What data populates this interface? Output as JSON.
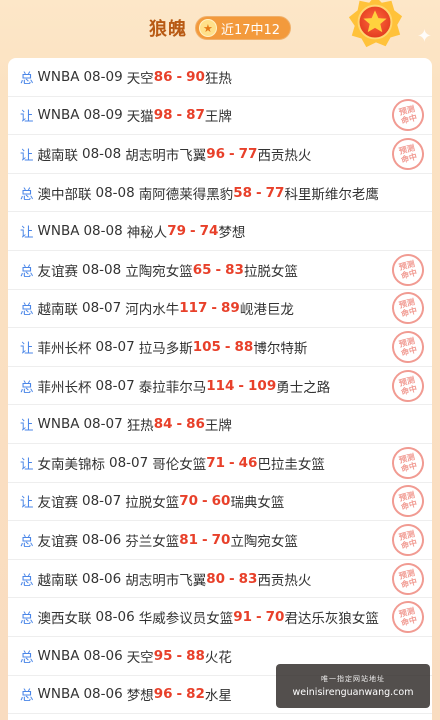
{
  "header": {
    "title": "狼魄",
    "badge_text": "近17中12",
    "badge_icon": "star-icon",
    "medal_icon": "star-medal-icon"
  },
  "stamp_text": {
    "line1": "预测",
    "line2": "命中"
  },
  "rows": [
    {
      "kind": "总",
      "league": "WNBA",
      "date": "08-09",
      "home": "天空",
      "score_home": "86",
      "score_away": "90",
      "away": "狂热",
      "hit": false
    },
    {
      "kind": "让",
      "league": "WNBA",
      "date": "08-09",
      "home": "天猫",
      "score_home": "98",
      "score_away": "87",
      "away": "王牌",
      "hit": true
    },
    {
      "kind": "让",
      "league": "越南联",
      "date": "08-08",
      "home": "胡志明市飞翼",
      "score_home": "96",
      "score_away": "77",
      "away": "西贡热火",
      "hit": true
    },
    {
      "kind": "总",
      "league": "澳中部联",
      "date": "08-08",
      "home": "南阿德莱得黑豹",
      "score_home": "58",
      "score_away": "77",
      "away": "科里斯维尔老鹰",
      "hit": false
    },
    {
      "kind": "让",
      "league": "WNBA",
      "date": "08-08",
      "home": "神秘人",
      "score_home": "79",
      "score_away": "74",
      "away": "梦想",
      "hit": false
    },
    {
      "kind": "总",
      "league": "友谊赛",
      "date": "08-08",
      "home": "立陶宛女篮",
      "score_home": "65",
      "score_away": "83",
      "away": "拉脱女篮",
      "hit": true
    },
    {
      "kind": "总",
      "league": "越南联",
      "date": "08-07",
      "home": "河内水牛",
      "score_home": "117",
      "score_away": "89",
      "away": "岘港巨龙",
      "hit": true
    },
    {
      "kind": "让",
      "league": "菲州长杯",
      "date": "08-07",
      "home": "拉马多斯",
      "score_home": "105",
      "score_away": "88",
      "away": "博尔特斯",
      "hit": true
    },
    {
      "kind": "总",
      "league": "菲州长杯",
      "date": "08-07",
      "home": "泰拉菲尔马",
      "score_home": "114",
      "score_away": "109",
      "away": "勇士之路",
      "hit": true
    },
    {
      "kind": "让",
      "league": "WNBA",
      "date": "08-07",
      "home": "狂热",
      "score_home": "84",
      "score_away": "86",
      "away": "王牌",
      "hit": false
    },
    {
      "kind": "让",
      "league": "女南美锦标",
      "date": "08-07",
      "home": "哥伦女篮",
      "score_home": "71",
      "score_away": "46",
      "away": "巴拉圭女篮",
      "hit": true
    },
    {
      "kind": "让",
      "league": "友谊赛",
      "date": "08-07",
      "home": "拉脱女篮",
      "score_home": "70",
      "score_away": "60",
      "away": "瑞典女篮",
      "hit": true
    },
    {
      "kind": "总",
      "league": "友谊赛",
      "date": "08-06",
      "home": "芬兰女篮",
      "score_home": "81",
      "score_away": "70",
      "away": "立陶宛女篮",
      "hit": true
    },
    {
      "kind": "总",
      "league": "越南联",
      "date": "08-06",
      "home": "胡志明市飞翼",
      "score_home": "80",
      "score_away": "83",
      "away": "西贡热火",
      "hit": true
    },
    {
      "kind": "总",
      "league": "澳西女联",
      "date": "08-06",
      "home": "华威参议员女篮",
      "score_home": "91",
      "score_away": "70",
      "away": "君达乐灰狼女篮",
      "hit": true
    },
    {
      "kind": "总",
      "league": "WNBA",
      "date": "08-06",
      "home": "天空",
      "score_home": "95",
      "score_away": "88",
      "away": "火花",
      "hit": false
    },
    {
      "kind": "总",
      "league": "WNBA",
      "date": "08-06",
      "home": "梦想",
      "score_home": "96",
      "score_away": "82",
      "away": "水星",
      "hit": false
    }
  ],
  "watermark": {
    "top_text": "唯一指定网站地址",
    "url": "weinisirenguanwang.com"
  },
  "colors": {
    "accent": "#f39a3c",
    "title": "#b85a14",
    "kind": "#4a86e8",
    "score": "#e8402a",
    "stamp": "#ef8a80"
  }
}
